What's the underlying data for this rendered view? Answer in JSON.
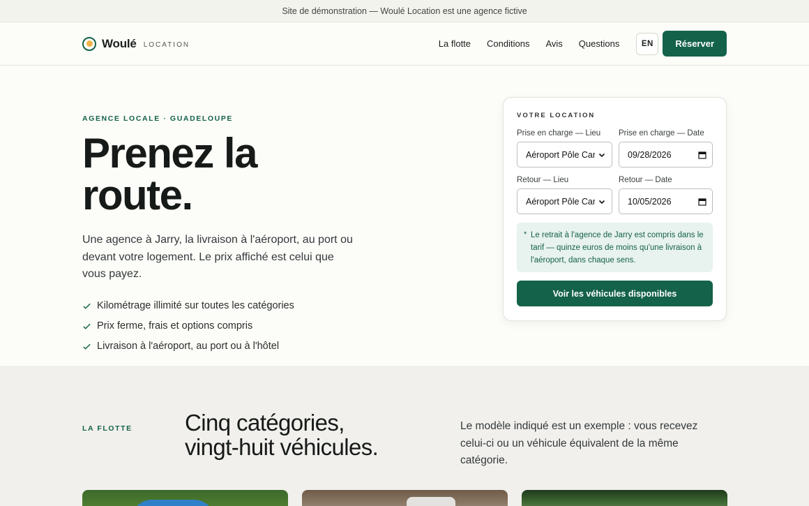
{
  "banner": {
    "text": "Site de démonstration — Woulé Location est une agence fictive"
  },
  "header": {
    "brand": "Woulé",
    "brand_sub": "LOCATION",
    "nav": [
      "La flotte",
      "Conditions",
      "Avis",
      "Questions"
    ],
    "lang": "EN",
    "cta": "Réserver"
  },
  "hero": {
    "eyebrow": "AGENCE LOCALE · GUADELOUPE",
    "title": "Prenez la route.",
    "description": "Une agence à Jarry, la livraison à l'aéroport, au port ou devant votre logement. Le prix affiché est celui que vous payez.",
    "features": [
      "Kilométrage illimité sur toutes les catégories",
      "Prix ferme, frais et options compris",
      "Livraison à l'aéroport, au port ou à l'hôtel"
    ]
  },
  "booking": {
    "title": "VOTRE LOCATION",
    "pickup_location_label": "Prise en charge — Lieu",
    "pickup_location_value": "Aéroport Pôle Caraïbes",
    "pickup_date_label": "Prise en charge — Date",
    "pickup_date_value": "09/28/2026",
    "return_location_label": "Retour — Lieu",
    "return_location_value": "Aéroport Pôle Caraïbes",
    "return_date_label": "Retour — Date",
    "return_date_value": "10/05/2026",
    "note_marker": "*",
    "note": "Le retrait à l'agence de Jarry est compris dans le tarif — quinze euros de moins qu'une livraison à l'aéroport, dans chaque sens.",
    "submit": "Voir les véhicules disponibles"
  },
  "fleet": {
    "eyebrow": "LA FLOTTE",
    "title_line1": "Cinq catégories,",
    "title_line2": "vingt-huit véhicules.",
    "description": "Le modèle indiqué est un exemple : vous recevez celui-ci ou un véhicule équivalent de la même catégorie."
  },
  "colors": {
    "accent": "#14624a",
    "logo_dot": "#f2b34a",
    "note_bg": "#e8f2ee"
  },
  "icons": {
    "feature": "check-icon",
    "select": "chevron-down-icon",
    "date": "calendar-icon"
  }
}
